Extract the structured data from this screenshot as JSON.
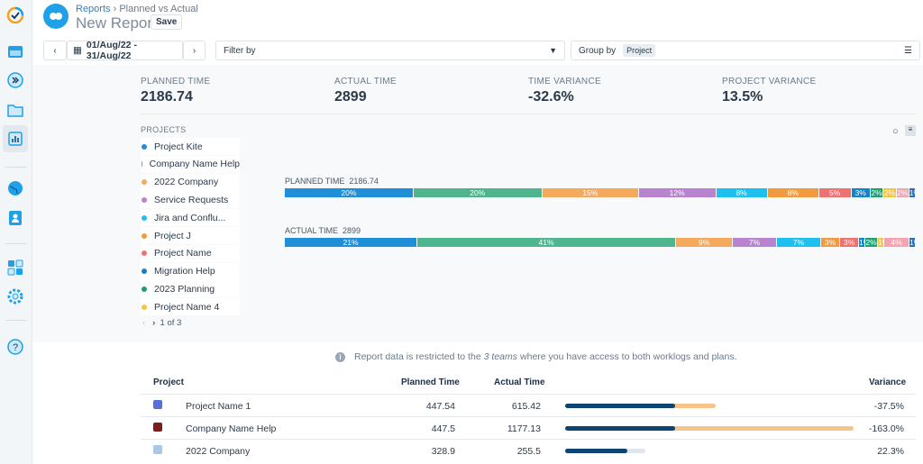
{
  "header": {
    "breadcrumb_root": "Reports",
    "breadcrumb_current": "Planned vs Actual",
    "title": "New Report",
    "save_label": "Save"
  },
  "toolbar": {
    "date_range": "01/Aug/22 - 31/Aug/22",
    "filter_label": "Filter by",
    "group_label": "Group by",
    "group_value": "Project"
  },
  "stats": [
    {
      "label": "PLANNED TIME",
      "value": "2186.74"
    },
    {
      "label": "ACTUAL TIME",
      "value": "2899"
    },
    {
      "label": "TIME VARIANCE",
      "value": "-32.6%"
    },
    {
      "label": "PROJECT VARIANCE",
      "value": "13.5%"
    }
  ],
  "legend": {
    "heading": "PROJECTS",
    "pagination": "1 of 3",
    "items": [
      {
        "label": "Project Kite",
        "color": "#1f8fd8"
      },
      {
        "label": "Company Name Help",
        "color": "#4fb58f"
      },
      {
        "label": "2022 Company",
        "color": "#f4a95c"
      },
      {
        "label": "Service Requests",
        "color": "#b883cf"
      },
      {
        "label": "Jira and Conflu...",
        "color": "#1ec0f0"
      },
      {
        "label": "Project J",
        "color": "#f19a3e"
      },
      {
        "label": "Project Name",
        "color": "#ef7272"
      },
      {
        "label": "Migration Help",
        "color": "#1682c8"
      },
      {
        "label": "2023 Planning",
        "color": "#1f9e72"
      },
      {
        "label": "Project Name 4",
        "color": "#f7c541"
      }
    ]
  },
  "segment_colors": [
    "#1f8fd8",
    "#4fb58f",
    "#f4a95c",
    "#b883cf",
    "#1ec0f0",
    "#f19a3e",
    "#ef7272",
    "#1682c8",
    "#1f9e72",
    "#f7c541",
    "#f4a4b0",
    "#2c6fb3"
  ],
  "planned_bar": {
    "label": "PLANNED TIME",
    "total": "2186.74",
    "percents": [
      20,
      20,
      15,
      12,
      8,
      8,
      5,
      3,
      2,
      2,
      2,
      1
    ]
  },
  "actual_bar": {
    "label": "ACTUAL TIME",
    "total": "2899",
    "percents": [
      21,
      41,
      9,
      7,
      7,
      3,
      3,
      1,
      2,
      1,
      4,
      1
    ]
  },
  "info": {
    "prefix": "Report data is restricted to the ",
    "emph": "3 teams",
    "suffix": " where you have access to both worklogs and plans."
  },
  "table": {
    "headers": {
      "project": "Project",
      "planned": "Planned Time",
      "actual": "Actual Time",
      "variance": "Variance"
    },
    "rows": [
      {
        "project": "Project Name 1",
        "planned": "447.54",
        "actual": "615.42",
        "variance": "-37.5%",
        "icon_color": "#5a6fd6"
      },
      {
        "project": "Company Name Help",
        "planned": "447.5",
        "actual": "1177.13",
        "variance": "-163.0%",
        "icon_color": "#7a1f1f"
      },
      {
        "project": "2022 Company",
        "planned": "328.9",
        "actual": "255.5",
        "variance": "22.3%",
        "icon_color": "#a9c8e8"
      }
    ]
  },
  "colors": {
    "planned_fill": "#0d4472",
    "over_fill": "#f6c48a",
    "under_fill": "#dde6ef"
  }
}
